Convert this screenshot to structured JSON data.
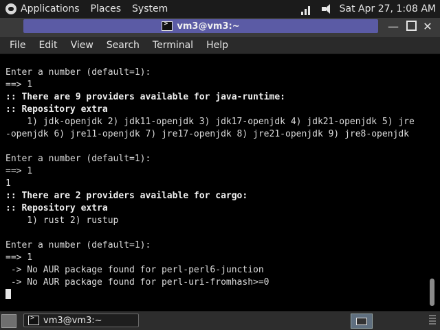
{
  "top_panel": {
    "menus": [
      "Applications",
      "Places",
      "System"
    ],
    "clock": "Sat Apr 27,  1:08 AM"
  },
  "window": {
    "title": "vm3@vm3:~",
    "controls": {
      "minimize": "—",
      "close": "✕"
    }
  },
  "menubar": [
    "File",
    "Edit",
    "View",
    "Search",
    "Terminal",
    "Help"
  ],
  "terminal": {
    "lines": [
      {
        "text": "Enter a number (default=1):",
        "bold": false
      },
      {
        "text": "==> 1",
        "bold": false
      },
      {
        "text": ":: There are 9 providers available for java-runtime:",
        "bold": true
      },
      {
        "text": ":: Repository extra",
        "bold": true
      },
      {
        "text": "    1) jdk-openjdk 2) jdk11-openjdk 3) jdk17-openjdk 4) jdk21-openjdk 5) jre",
        "bold": false
      },
      {
        "text": "-openjdk 6) jre11-openjdk 7) jre17-openjdk 8) jre21-openjdk 9) jre8-openjdk",
        "bold": false
      },
      {
        "text": "",
        "bold": false
      },
      {
        "text": "Enter a number (default=1):",
        "bold": false
      },
      {
        "text": "==> 1",
        "bold": false
      },
      {
        "text": "1",
        "bold": false
      },
      {
        "text": ":: There are 2 providers available for cargo:",
        "bold": true
      },
      {
        "text": ":: Repository extra",
        "bold": true
      },
      {
        "text": "    1) rust 2) rustup",
        "bold": false
      },
      {
        "text": "",
        "bold": false
      },
      {
        "text": "Enter a number (default=1):",
        "bold": false
      },
      {
        "text": "==> 1",
        "bold": false
      },
      {
        "text": " -> No AUR package found for perl-perl6-junction",
        "bold": false
      },
      {
        "text": " -> No AUR package found for perl-uri-fromhash>=0",
        "bold": false
      }
    ]
  },
  "taskbar": {
    "task_label": "vm3@vm3:~"
  },
  "colors": {
    "title_accent": "#5b5ba5",
    "terminal_bg": "#000000",
    "terminal_fg": "#dcdcdc"
  }
}
